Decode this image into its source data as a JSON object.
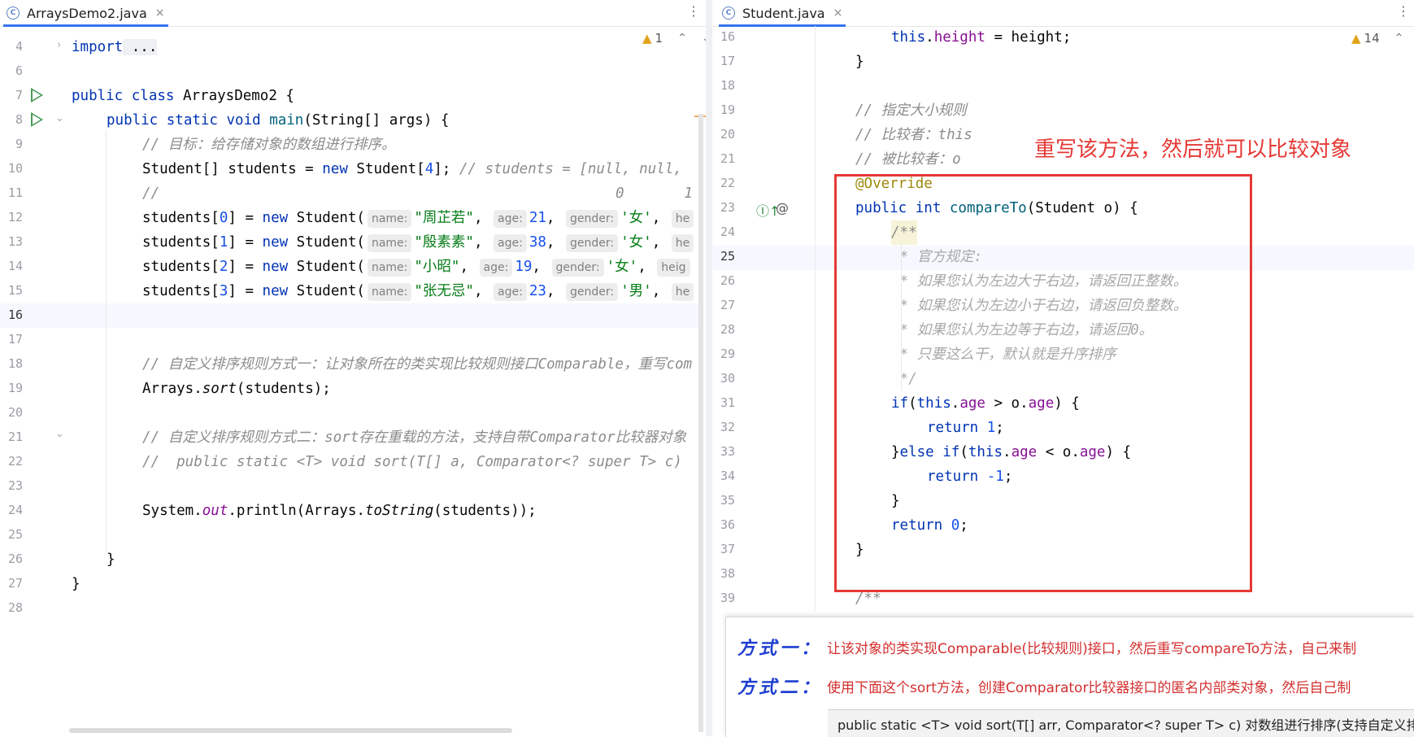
{
  "left_tab": {
    "filename": "ArraysDemo2.java",
    "close": "×",
    "menu": "⋮"
  },
  "right_tab": {
    "filename": "Student.java",
    "close": "×",
    "menu": "⋮"
  },
  "left_warning": {
    "count": "1",
    "up": "⌃",
    "down": "⌄"
  },
  "right_warning": {
    "count": "14",
    "up": "⌃"
  },
  "file_icon_letter": "C",
  "left_lines": [
    "4",
    "6",
    "7",
    "8",
    "9",
    "10",
    "11",
    "12",
    "13",
    "14",
    "15",
    "16",
    "17",
    "18",
    "19",
    "20",
    "21",
    "22",
    "23",
    "24",
    "25",
    "26",
    "27",
    "28"
  ],
  "right_lines": [
    "16",
    "17",
    "18",
    "19",
    "20",
    "21",
    "22",
    "23",
    "24",
    "25",
    "26",
    "27",
    "28",
    "29",
    "30",
    "31",
    "32",
    "33",
    "34",
    "35",
    "36",
    "37",
    "38",
    "39"
  ],
  "left_code": {
    "l4": {
      "kw": "import",
      "rest": " ..."
    },
    "l7": {
      "kw": "public class",
      "name": " ArraysDemo2 {"
    },
    "l8": {
      "kw": "public static void",
      "fn": " main",
      "rest": "(String[] args) {"
    },
    "l9": "// 目标：给存储对象的数组进行排序。",
    "l10": {
      "a": "Student[] students = ",
      "kw": "new",
      "b": " Student[",
      "num": "4",
      "c": "]; ",
      "cmt": "// students = [null, null,"
    },
    "l11": {
      "cmt": "//",
      "cols": "0       1"
    },
    "students": [
      {
        "idx": "0",
        "name": "\"周芷若\"",
        "age": "21",
        "gender": "'女'"
      },
      {
        "idx": "1",
        "name": "\"殷素素\"",
        "age": "38",
        "gender": "'女'"
      },
      {
        "idx": "2",
        "name": "\"小昭\"",
        "age": "19",
        "gender": "'女'"
      },
      {
        "idx": "3",
        "name": "\"张无忌\"",
        "age": "23",
        "gender": "'男'"
      }
    ],
    "hint_name": "name:",
    "hint_age": "age:",
    "hint_gender": "gender:",
    "hint_height_1": "he",
    "hint_height_3": "heig",
    "l18": "// 自定义排序规则方式一：让对象所在的类实现比较规则接口Comparable，重写com",
    "l19": {
      "a": "Arrays.",
      "m": "sort",
      "b": "(students);"
    },
    "l21": "// 自定义排序规则方式二：sort存在重载的方法，支持自带Comparator比较器对象",
    "l22": "//  public static <T> void sort(T[] a, Comparator<? super T> c)",
    "l24": {
      "a": "System.",
      "f": "out",
      "b": ".println(Arrays.",
      "m": "toString",
      "c": "(students));"
    },
    "l26": "}",
    "l27": "}"
  },
  "right_code": {
    "r16": {
      "kw": "this",
      "a": ".",
      "fld": "height",
      "b": " = height;"
    },
    "r17": "}",
    "r19": "// 指定大小规则",
    "r20": "// 比较者：this",
    "r21": "// 被比较者：o",
    "r22": "@Override",
    "r23": {
      "kw": "public int",
      "fn": " compareTo",
      "rest": "(Student o) {"
    },
    "r24": "/**",
    "r25": " * 官方规定:",
    "r26": " * 如果您认为左边大于右边，请返回正整数。",
    "r27": " * 如果您认为左边小于右边，请返回负整数。",
    "r28": " * 如果您认为左边等于右边，请返回0。",
    "r29": " * 只要这么干，默认就是升序排序",
    "r30": " */",
    "r31": {
      "kw1": "if",
      "a": "(",
      "kw2": "this",
      "b": ".",
      "f1": "age",
      "c": " > o.",
      "f2": "age",
      "d": ") {"
    },
    "r32": {
      "kw": "return",
      "num": " 1",
      "rest": ";"
    },
    "r33": {
      "a": "}",
      "kw1": "else if",
      "b": "(",
      "kw2": "this",
      "c": ".",
      "f1": "age",
      "d": " < o.",
      "f2": "age",
      "e": ") {"
    },
    "r34": {
      "kw": "return",
      "num": " -1",
      "rest": ";"
    },
    "r35": "}",
    "r36": {
      "kw": "return",
      "num": " 0",
      "rest": ";"
    },
    "r37": "}",
    "r39": "/**"
  },
  "callout": "重写该方法，然后就可以比较对象",
  "popup": {
    "label1": "方式一：",
    "text1": "让该对象的类实现Comparable(比较规则)接口，然后重写compareTo方法，自己来制",
    "label2": "方式二：",
    "text2": "使用下面这个sort方法，创建Comparator比较器接口的匿名内部类对象，然后自己制",
    "signature": "public static <T> void sort(T[] arr, Comparator<? super T> c)    对数组进行排序(支持自定义排"
  },
  "colors": {
    "accent": "#3574f0",
    "annotation_red": "#e53935",
    "keyword": "#0033b3",
    "string": "#067d17"
  }
}
